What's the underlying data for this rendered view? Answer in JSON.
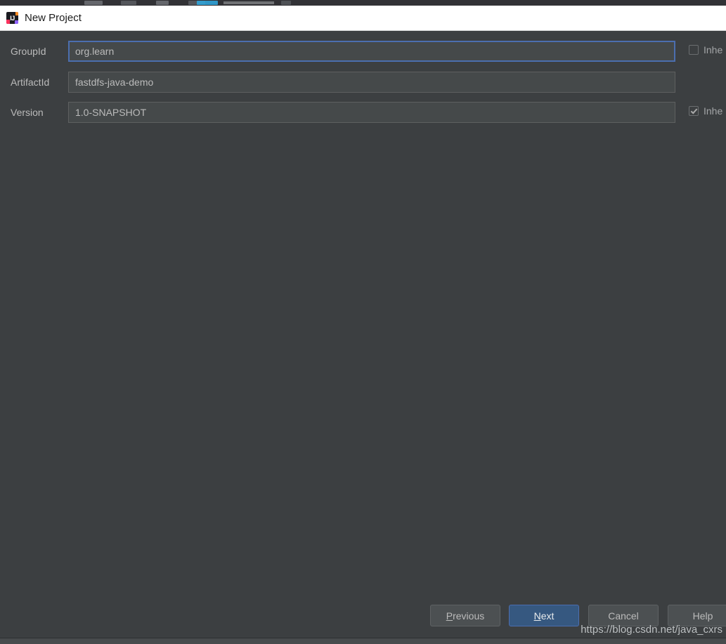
{
  "window": {
    "title": "New Project",
    "app_icon": "intellij-idea-icon",
    "icon_letters": "IJ"
  },
  "background_app": {
    "visible": true,
    "description": "partially visible toolbar of application behind dialog"
  },
  "form": {
    "fields": [
      {
        "label": "GroupId",
        "value": "org.learn",
        "placeholder": "GroupId",
        "focused": true,
        "name": "groupid"
      },
      {
        "label": "ArtifactId",
        "value": "fastdfs-java-demo",
        "placeholder": "ArtifactId",
        "focused": false,
        "name": "artifactid"
      },
      {
        "label": "Version",
        "value": "1.0-SNAPSHOT",
        "placeholder": "Version",
        "focused": false,
        "name": "version"
      }
    ],
    "checkboxes": [
      {
        "label": "Inhe",
        "checked": false,
        "name": "inherit-groupid"
      },
      {
        "label": "Inhe",
        "checked": true,
        "name": "inherit-version"
      }
    ]
  },
  "buttons": {
    "previous": {
      "mnemonic": "P",
      "rest": "revious"
    },
    "next": {
      "mnemonic": "N",
      "rest": "ext"
    },
    "cancel": {
      "label": "Cancel"
    },
    "help": {
      "label": "Help"
    }
  },
  "watermark": {
    "text": "https://blog.csdn.net/java_cxrs"
  },
  "colors": {
    "dialog_background": "#3c3f41",
    "titlebar_background": "#ffffff",
    "field_background": "#45494a",
    "focus_border": "#4b6eaf",
    "default_button": "#365880",
    "text": "#bbbbbb"
  }
}
